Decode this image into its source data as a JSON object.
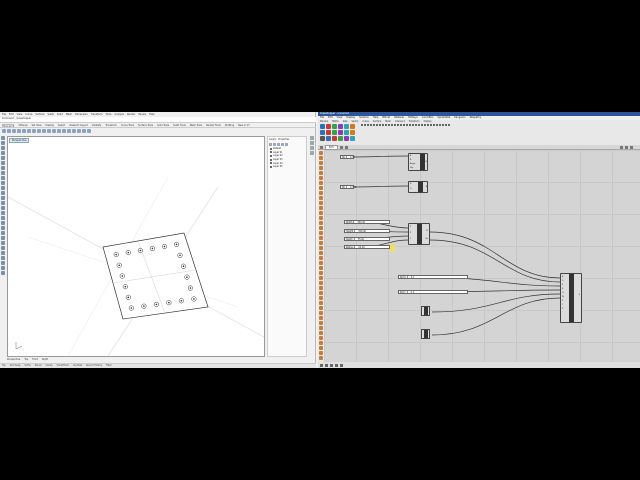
{
  "rhino": {
    "menu": [
      "File",
      "Edit",
      "View",
      "Curve",
      "Surface",
      "SubD",
      "Solid",
      "Mesh",
      "Dimension",
      "Transform",
      "Tools",
      "Analyze",
      "Render",
      "Panels",
      "Help"
    ],
    "command_text": "Command: _Grasshopper",
    "tabs": [
      "Standard",
      "CPlanes",
      "Set View",
      "Display",
      "Select",
      "Viewport Layout",
      "Visibility",
      "Transform",
      "Curve Tools",
      "Surface Tools",
      "Solid Tools",
      "SubD Tools",
      "Mesh Tools",
      "Render Tools",
      "Drafting",
      "New in V7"
    ],
    "viewport_label": "Perspective",
    "viewport_tabs": [
      "Perspective",
      "Top",
      "Front",
      "Right"
    ],
    "status": [
      "Top",
      "Grid Snap",
      "Ortho",
      "Planar",
      "Osnap",
      "SmartTrack",
      "Gumball",
      "Record History",
      "Filter"
    ],
    "panel_tabs": [
      "Layers",
      "Properties"
    ],
    "layers": [
      {
        "name": "Default",
        "color": "#000000"
      },
      {
        "name": "Layer 01",
        "color": "#ff0000"
      },
      {
        "name": "Layer 02",
        "color": "#0000ff"
      },
      {
        "name": "Layer 03",
        "color": "#00aa00"
      },
      {
        "name": "Layer 04",
        "color": "#ffffff"
      },
      {
        "name": "Layer 05",
        "color": "#888888"
      }
    ]
  },
  "grasshopper": {
    "title": "Grasshopper - unnamed",
    "menu": [
      "File",
      "Edit",
      "View",
      "Display",
      "Solution",
      "Help",
      "Bifrost",
      "Wallacei",
      "HotKeys",
      "LunchBox",
      "SpiderWeb",
      "Kangaroo",
      "Telepathy"
    ],
    "tabs": [
      "Params",
      "Maths",
      "Sets",
      "Vector",
      "Curve",
      "Surface",
      "Mesh",
      "Intersect",
      "Transform",
      "Display"
    ],
    "zoom": "83%",
    "sliders": [
      {
        "label": "No",
        "value": "0.77"
      },
      {
        "label": "No",
        "value": "0.775"
      },
      {
        "label": "Width",
        "value": "350.00"
      },
      {
        "label": "Height",
        "value": "350.00"
      },
      {
        "label": "Depth",
        "value": "35.00"
      },
      {
        "label": "Radius",
        "value": "24.00"
      },
      {
        "label": "Rot X",
        "value": "0.1"
      },
      {
        "label": "Rot Y",
        "value": "0.1"
      }
    ],
    "comp1": {
      "ports_in": [
        "A",
        "B",
        "Angle",
        "Flip"
      ],
      "ports_out": [
        "R"
      ]
    },
    "comp2": {
      "ports_in": [
        "R",
        "D"
      ],
      "ports_out": [
        "B"
      ]
    },
    "comp3": {
      "ports_in": [
        "P",
        "X",
        "Y"
      ],
      "ports_out": [
        "Pl",
        "Bx"
      ]
    },
    "comp4": {
      "ports_in": [
        "B",
        "D",
        "E",
        "R",
        "G",
        "W",
        "X",
        "Y",
        "Z"
      ],
      "ports_out": [
        "E"
      ]
    }
  },
  "colors": {
    "gh_title": "#2b579a",
    "highlight": "#f6e34a"
  }
}
